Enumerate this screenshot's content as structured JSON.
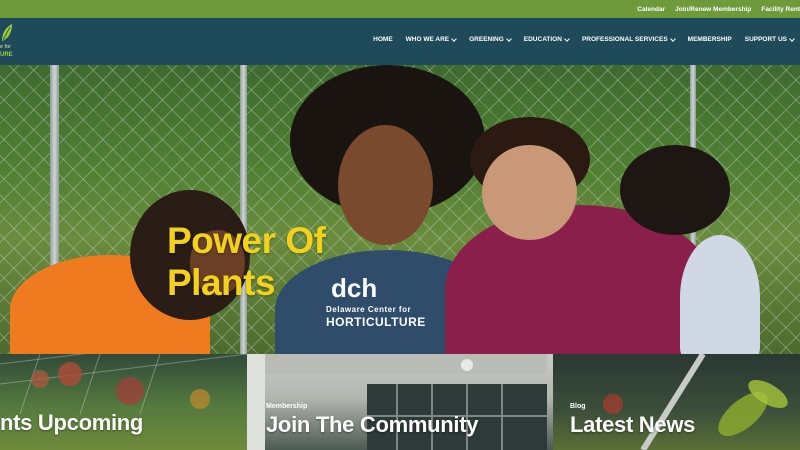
{
  "topbar": {
    "links": [
      "Calendar",
      "Join/Renew Membership",
      "Facility Rent"
    ]
  },
  "logo": {
    "line1": "e for",
    "line2": "URE",
    "icon": "leaf-logo-icon"
  },
  "nav": {
    "items": [
      {
        "label": "HOME",
        "has_dropdown": false
      },
      {
        "label": "WHO WE ARE",
        "has_dropdown": true
      },
      {
        "label": "GREENING",
        "has_dropdown": true
      },
      {
        "label": "EDUCATION",
        "has_dropdown": true
      },
      {
        "label": "PROFESSIONAL SERVICES",
        "has_dropdown": true
      },
      {
        "label": "MEMBERSHIP",
        "has_dropdown": false
      },
      {
        "label": "SUPPORT US",
        "has_dropdown": true
      }
    ]
  },
  "hero": {
    "title_line1": "Power Of",
    "title_line2": "Plants",
    "shirt_logo": "dch",
    "shirt_line1": "Delaware Center for",
    "shirt_line2": "HORTICULTURE"
  },
  "cards": [
    {
      "category": "",
      "title": "nts Upcoming"
    },
    {
      "category": "Membership",
      "title": "Join The Community"
    },
    {
      "category": "Blog",
      "title": "Latest News"
    }
  ],
  "colors": {
    "topbar": "#6e9a3c",
    "navbar": "#1e4a5a",
    "hero_title": "#f2d21c"
  }
}
